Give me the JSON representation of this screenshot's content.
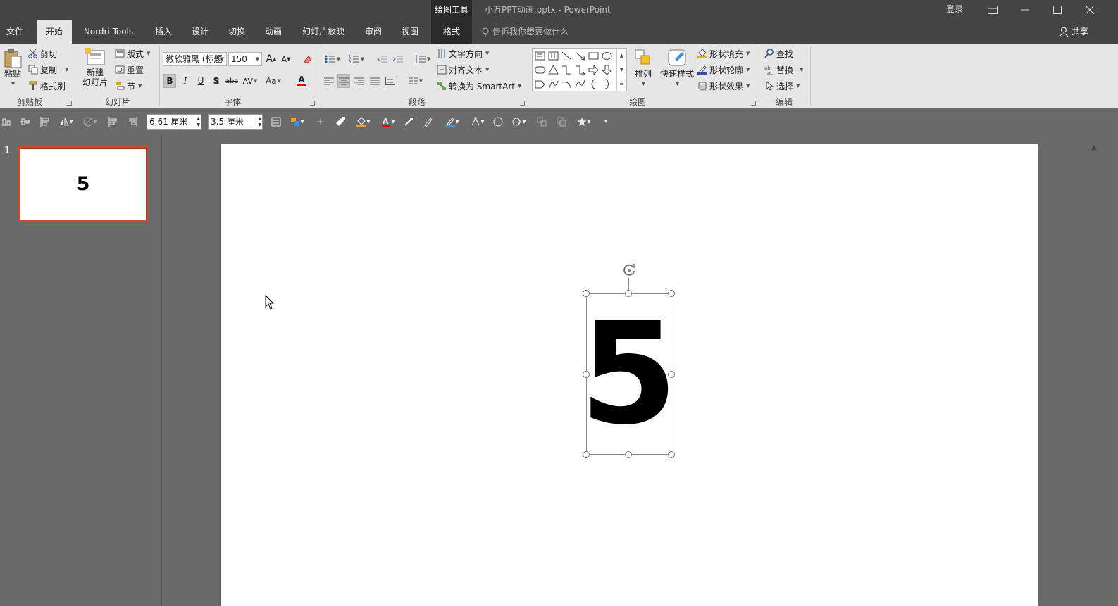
{
  "titlebar": {
    "context_header": "绘图工具",
    "doc_title": "小万PPT动画.pptx  -  PowerPoint",
    "login": "登录"
  },
  "tabs": [
    "文件",
    "开始",
    "Nordri Tools",
    "插入",
    "设计",
    "切换",
    "动画",
    "幻灯片放映",
    "审阅",
    "视图",
    "格式"
  ],
  "tell_me": "告诉我你想要做什么",
  "share": "共享",
  "clipboard": {
    "paste": "粘贴",
    "cut": "剪切",
    "copy": "复制",
    "format_painter": "格式刷",
    "label": "剪贴板"
  },
  "slides_group": {
    "new_slide_1": "新建",
    "new_slide_2": "幻灯片",
    "layout": "版式",
    "reset": "重置",
    "section": "节",
    "label": "幻灯片"
  },
  "font_group": {
    "font_name": "微软雅黑 (标题",
    "font_size": "150",
    "label": "字体",
    "bold": "B",
    "italic": "I",
    "underline": "U",
    "shadow": "S",
    "strike": "abc",
    "spacing": "AV",
    "case": "Aa",
    "color": "A",
    "grow": "A",
    "shrink": "A"
  },
  "paragraph_group": {
    "text_direction": "文字方向",
    "align_text": "对齐文本",
    "smartart": "转换为 SmartArt",
    "label": "段落"
  },
  "drawing_group": {
    "arrange": "排列",
    "quick_styles": "快速样式",
    "shape_fill": "形状填充",
    "shape_outline": "形状轮廓",
    "shape_effects": "形状效果",
    "label": "绘图"
  },
  "editing_group": {
    "find": "查找",
    "replace": "替换",
    "select": "选择",
    "label": "编辑"
  },
  "format_toolbar": {
    "width": "6.61 厘米",
    "height": "3.5 厘米"
  },
  "thumbnails": [
    {
      "number": "1",
      "text": "5"
    }
  ],
  "slide": {
    "text": "5"
  },
  "colors": {
    "accent": "#d24726",
    "titlebar": "#444444",
    "ribbon": "#e6e6e6",
    "workspace": "#6a6a6a"
  }
}
